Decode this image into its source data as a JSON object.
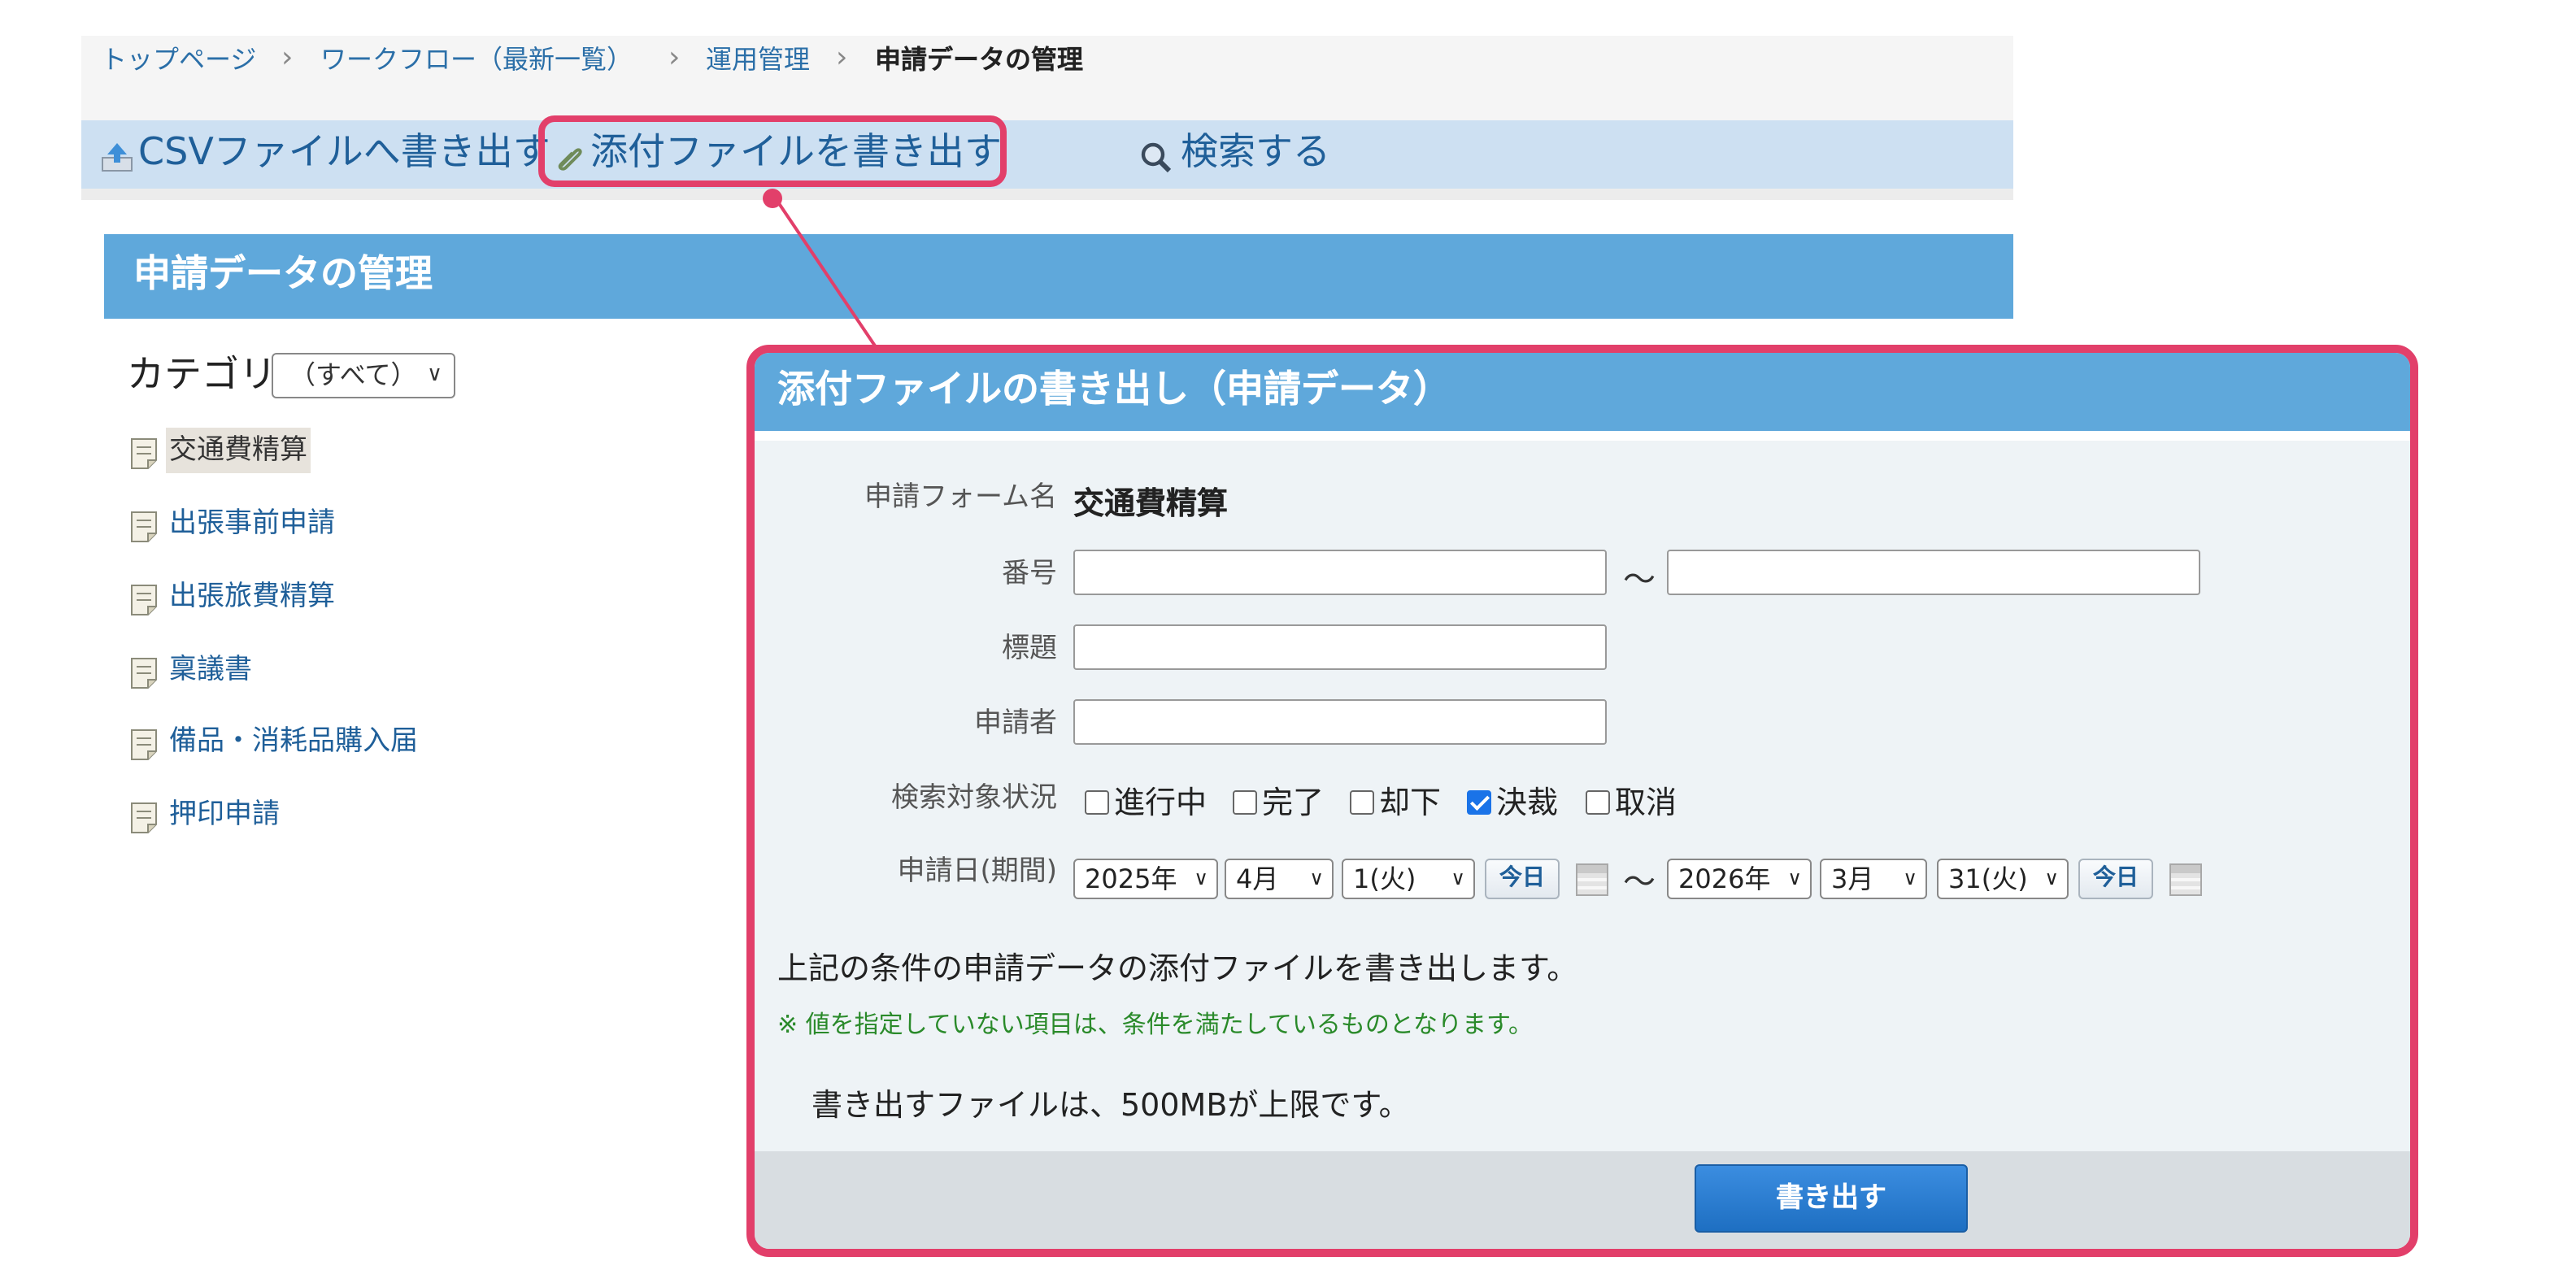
{
  "breadcrumb": {
    "items": [
      "トップページ",
      "ワークフロー（最新一覧）",
      "運用管理",
      "申請データの管理"
    ]
  },
  "toolbar": {
    "csv_export": "CSVファイルへ書き出す",
    "attachment_export": "添付ファイルを書き出す",
    "search": "検索する"
  },
  "page": {
    "title": "申請データの管理"
  },
  "sidebar": {
    "category_label": "カテゴリ",
    "category_selected": "（すべて）",
    "forms": [
      {
        "label": "交通費精算",
        "selected": true
      },
      {
        "label": "出張事前申請",
        "selected": false
      },
      {
        "label": "出張旅費精算",
        "selected": false
      },
      {
        "label": "稟議書",
        "selected": false
      },
      {
        "label": "備品・消耗品購入届",
        "selected": false
      },
      {
        "label": "押印申請",
        "selected": false
      }
    ]
  },
  "dialog": {
    "title": "添付ファイルの書き出し（申請データ）",
    "form_name_label": "申請フォーム名",
    "form_name_value": "交通費精算",
    "number_label": "番号",
    "number_from": "",
    "number_to": "",
    "range_separator": "～",
    "subject_label": "標題",
    "subject_value": "",
    "applicant_label": "申請者",
    "applicant_value": "",
    "status_label": "検索対象状況",
    "statuses": [
      {
        "label": "進行中",
        "checked": false
      },
      {
        "label": "完了",
        "checked": false
      },
      {
        "label": "却下",
        "checked": false
      },
      {
        "label": "決裁",
        "checked": true
      },
      {
        "label": "取消",
        "checked": false
      }
    ],
    "date_label": "申請日(期間)",
    "date_from": {
      "year": "2025年",
      "month": "4月",
      "day": "1(火)"
    },
    "date_to": {
      "year": "2026年",
      "month": "3月",
      "day": "31(火)"
    },
    "today_label": "今日",
    "description": "上記の条件の申請データの添付ファイルを書き出します。",
    "note": "※ 値を指定していない項目は、条件を満たしているものとなります。",
    "limit": "書き出すファイルは、500MBが上限です。",
    "export_button": "書き出す"
  },
  "colors": {
    "accent": "#5fa8db",
    "highlight": "#e23f6a",
    "link": "#1f5f99",
    "note": "#2a8a2a"
  }
}
